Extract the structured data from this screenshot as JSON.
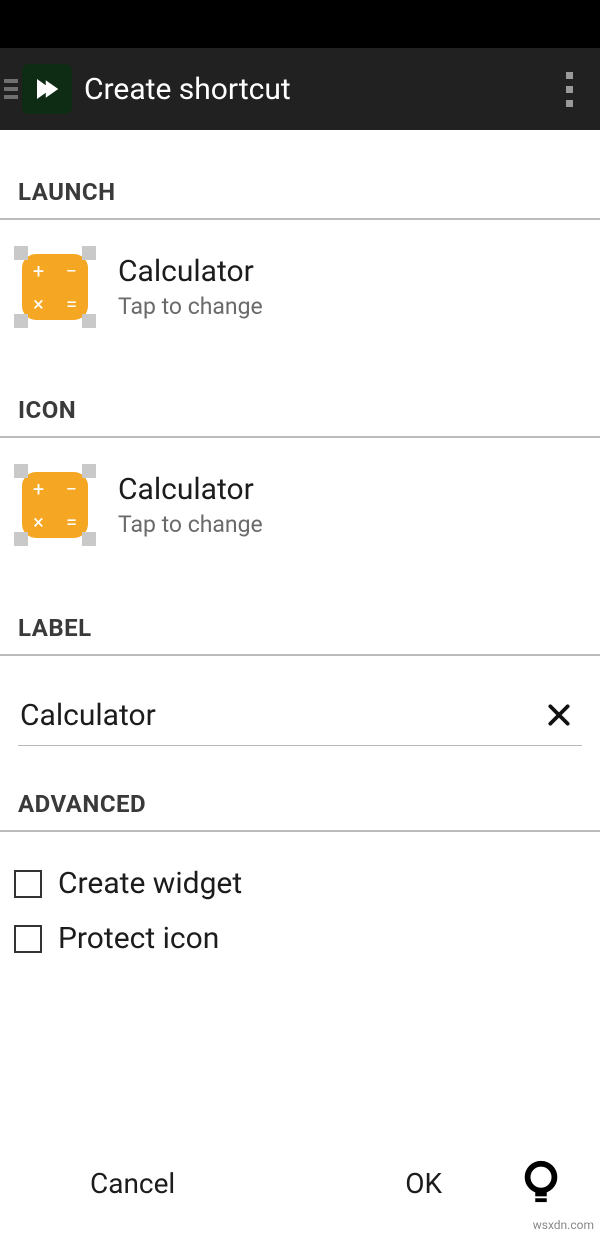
{
  "appbar": {
    "title": "Create shortcut"
  },
  "sections": {
    "launch": {
      "header": "LAUNCH",
      "title": "Calculator",
      "subtitle": "Tap to change"
    },
    "icon": {
      "header": "ICON",
      "title": "Calculator",
      "subtitle": "Tap to change"
    },
    "label": {
      "header": "LABEL",
      "value": "Calculator"
    },
    "advanced": {
      "header": "ADVANCED",
      "create_widget": "Create widget",
      "protect_icon": "Protect icon"
    }
  },
  "buttons": {
    "cancel": "Cancel",
    "ok": "OK"
  },
  "watermark": "wsxdn.com"
}
